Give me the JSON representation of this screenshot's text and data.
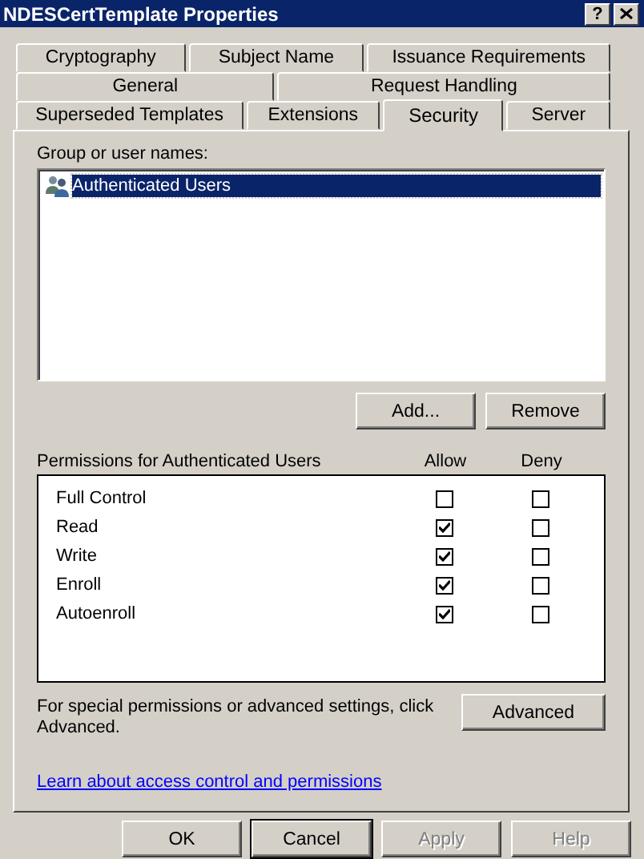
{
  "window": {
    "title": "NDESCertTemplate Properties",
    "help_button": "?"
  },
  "tab_rows": [
    [
      {
        "label": "Cryptography",
        "selected": false
      },
      {
        "label": "Subject Name",
        "selected": false
      },
      {
        "label": "Issuance Requirements",
        "selected": false
      }
    ],
    [
      {
        "label": "General",
        "selected": false
      },
      {
        "label": "Request Handling",
        "selected": false
      }
    ],
    [
      {
        "label": "Superseded Templates",
        "selected": false
      },
      {
        "label": "Extensions",
        "selected": false
      },
      {
        "label": "Security",
        "selected": true
      },
      {
        "label": "Server",
        "selected": false
      }
    ]
  ],
  "group_label": "Group or user names:",
  "users": [
    {
      "name": "Authenticated Users",
      "selected": true
    }
  ],
  "user_buttons": [
    "Add...",
    "Remove"
  ],
  "permissions": {
    "title": "Permissions for Authenticated Users",
    "columns": [
      "Allow",
      "Deny"
    ],
    "rows": [
      {
        "name": "Full Control",
        "allow": false,
        "deny": false
      },
      {
        "name": "Read",
        "allow": true,
        "deny": false
      },
      {
        "name": "Write",
        "allow": true,
        "deny": false
      },
      {
        "name": "Enroll",
        "allow": true,
        "deny": false
      },
      {
        "name": "Autoenroll",
        "allow": true,
        "deny": false
      }
    ]
  },
  "advanced_text": "For special permissions or advanced settings, click Advanced.",
  "advanced_button": "Advanced",
  "link": "Learn about access control and permissions",
  "footer_buttons": [
    {
      "label": "OK",
      "disabled": false,
      "default": false
    },
    {
      "label": "Cancel",
      "disabled": false,
      "default": true
    },
    {
      "label": "Apply",
      "disabled": true,
      "default": false
    },
    {
      "label": "Help",
      "disabled": true,
      "default": false
    }
  ]
}
